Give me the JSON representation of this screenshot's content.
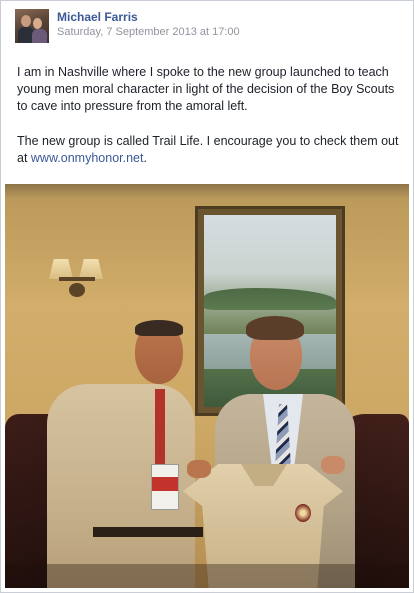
{
  "post": {
    "author": "Michael Farris",
    "timestamp": "Saturday, 7 September 2013 at 17:00",
    "paragraph1": "I am in Nashville where I spoke to the new group launched to teach young men moral character in light of the decision of the Boy Scouts to cave into pressure from the amoral left.",
    "paragraph2_prefix": "The new group is called Trail Life. I encourage you to check them out at ",
    "link_text": "www.onmyhonor.net",
    "paragraph2_suffix": "."
  },
  "colors": {
    "link": "#3b5998",
    "text": "#1d2129",
    "timestamp": "#90949c",
    "border": "#c9cdd6"
  },
  "icons": {
    "avatar": "profile-photo"
  }
}
